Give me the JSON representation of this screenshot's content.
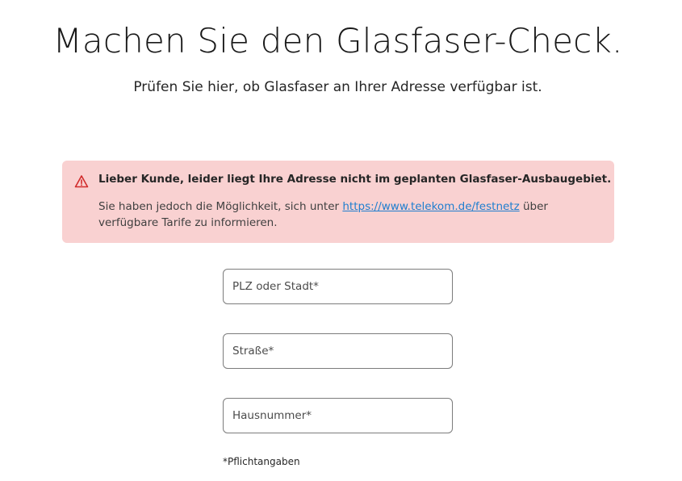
{
  "header": {
    "title": "Machen Sie den Glasfaser-Check.",
    "subtitle": "Prüfen Sie hier, ob Glasfaser an Ihrer Adresse verfügbar ist."
  },
  "alert": {
    "icon": "warning-triangle-icon",
    "heading": "Lieber Kunde, leider liegt Ihre Adresse nicht im geplanten Glasfaser-Ausbaugebiet.",
    "body_before_link": "Sie haben jedoch die Möglichkeit, sich unter ",
    "link_text": "https://www.telekom.de/festnetz",
    "body_after_link": " über verfügbare Tarife zu informieren.",
    "colors": {
      "background": "#f9d1d1",
      "icon": "#d12a2a",
      "link": "#1f7ecf"
    }
  },
  "form": {
    "plz": {
      "value": "",
      "placeholder": "PLZ oder Stadt*"
    },
    "strasse": {
      "value": "",
      "placeholder": "Straße*"
    },
    "hausnummer": {
      "value": "",
      "placeholder": "Hausnummer*"
    },
    "required_note": "*Pflichtangaben"
  }
}
